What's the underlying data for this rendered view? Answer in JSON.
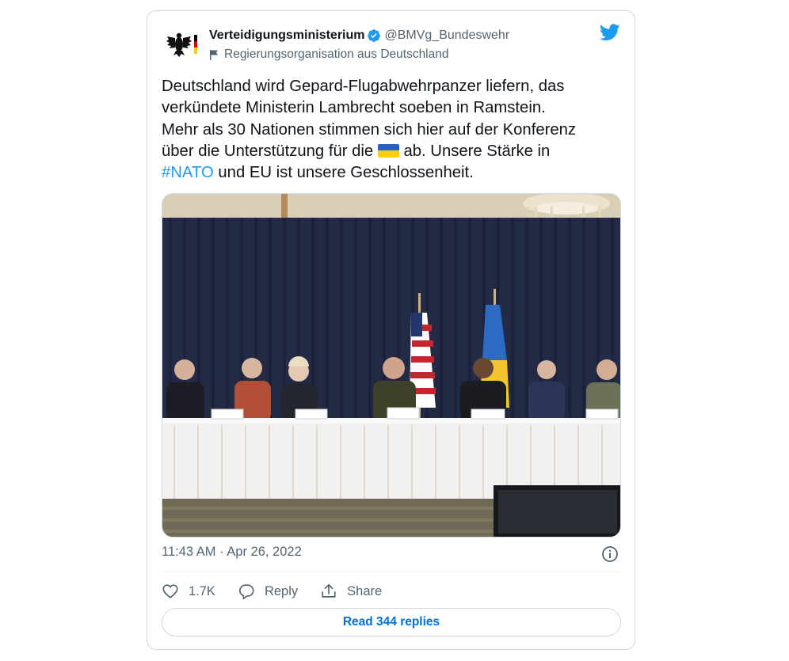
{
  "author": {
    "name": "Verteidigungsministerium",
    "handle": "@BMVg_Bundeswehr",
    "label": "Regierungsorganisation aus Deutschland",
    "verified": true,
    "avatar_icon": "federal-eagle-logo"
  },
  "tweet": {
    "text_part1": "Deutschland wird Gepard-Flugabwehrpanzer liefern, das\nverkündete Ministerin Lambrecht soeben in Ramstein.\nMehr als 30 Nationen stimmen sich hier auf der Konferenz\nüber die Unterstützung für die ",
    "flag_emoji": "ukraine-flag-icon",
    "text_part2": " ab. Unsere Stärke in\n",
    "hashtag": "#NATO",
    "text_part3": " und EU ist unsere Geschlossenheit."
  },
  "media": {
    "description_icon": "conference-photo",
    "colors": {
      "curtain": "#232a45",
      "tablecloth": "#f3f1ef",
      "carpet": "#6f6a55"
    }
  },
  "meta": {
    "time": "11:43 AM",
    "separator": " · ",
    "date": "Apr 26, 2022"
  },
  "actions": {
    "likes_count": "1.7K",
    "reply_label": "Reply",
    "share_label": "Share"
  },
  "replies_button": "Read 344 replies",
  "colors": {
    "brand": "#1d9bf0",
    "link": "#006fd6",
    "muted": "#536471"
  }
}
